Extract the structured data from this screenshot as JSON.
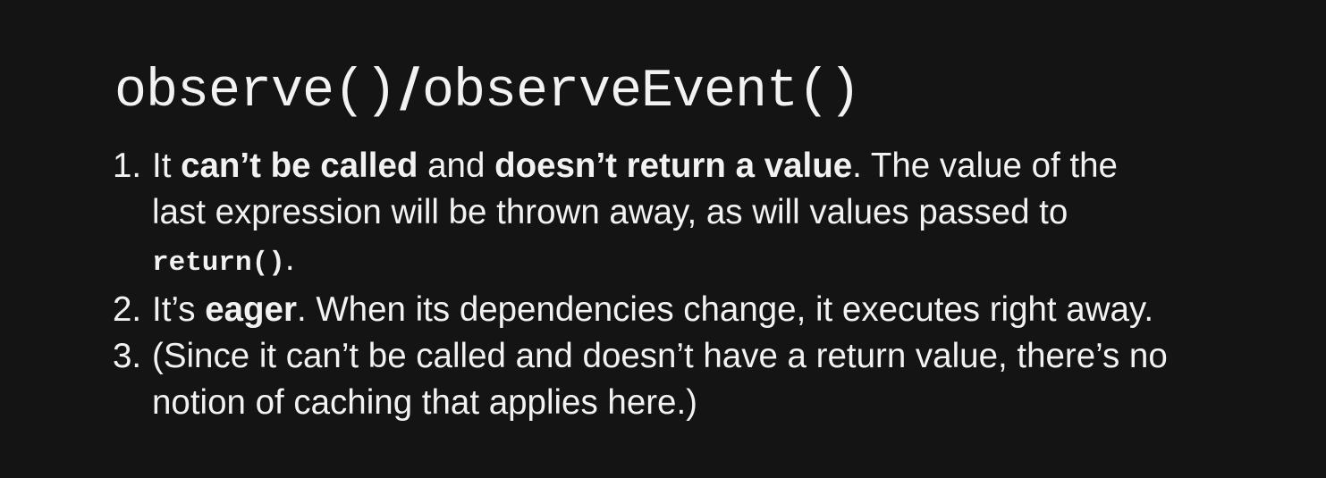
{
  "slide": {
    "title_part1": "observe()",
    "title_separator": "/",
    "title_part2": "observeEvent()",
    "points": [
      {
        "number": "1.",
        "line1_pre": "It ",
        "line1_bold1": "can’t be called",
        "line1_mid": " and ",
        "line1_bold2": "doesn’t return a value",
        "line1_post": ". The value of the",
        "line2": "last expression will be thrown away, as will values passed to",
        "line3_code": "return()",
        "line3_post": "."
      },
      {
        "number": "2.",
        "pre": "It’s ",
        "bold": "eager",
        "post": ". When its dependencies change, it executes right away."
      },
      {
        "number": "3.",
        "line1": "(Since it can’t be called and doesn’t have a return value, there’s no",
        "line2": "notion of caching that applies here.)"
      }
    ]
  }
}
